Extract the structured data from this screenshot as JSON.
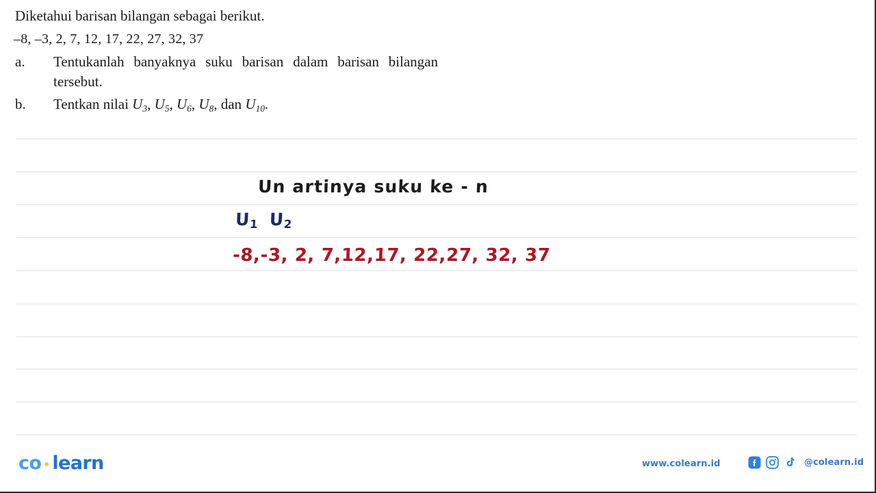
{
  "question": {
    "intro": "Diketahui barisan bilangan sebagai berikut.",
    "sequence": "–8, –3, 2, 7, 12, 17, 22, 27, 32, 37",
    "items": [
      {
        "label": "a.",
        "text": "Tentukanlah banyaknya suku barisan dalam barisan bilangan tersebut."
      },
      {
        "label": "b.",
        "text_prefix": "Tentkan nilai ",
        "terms": [
          "U3",
          "U5",
          "U6",
          "U8"
        ],
        "conjunction": "dan ",
        "last_term": "U10",
        "terms_display": [
          "U",
          "3",
          "U",
          "5",
          "U",
          "6",
          "U",
          "8",
          "U",
          "10"
        ]
      }
    ],
    "b_label": "b.",
    "b_lead": "Tentkan nilai",
    "b_sub1": "3",
    "b_sub2": "5",
    "b_sub3": "6",
    "b_sub4": "8",
    "b_dan": "dan",
    "b_sub5": "10",
    "b_U": "U",
    "b_end": "."
  },
  "handwriting": {
    "note_title_main": "Un",
    "note_title_rest": " artinya suku ke - n",
    "u_first": "U",
    "u_first_sub": "1",
    "u_second": "U",
    "u_second_sub": "2",
    "red_sequence": "-8,-3, 2, 7,12,17, 22,27, 32, 37",
    "colors": {
      "black_ink": "#1b1b1b",
      "blue_ink": "#1d2b63",
      "red_ink": "#ad1723"
    }
  },
  "rules": {
    "line_positions": [
      202,
      250,
      298,
      346,
      394,
      443,
      491,
      538,
      586,
      634
    ],
    "color": "#ececec"
  },
  "footer": {
    "logo_first": "co",
    "logo_second": "learn",
    "website": "www.colearn.id",
    "handle": "@colearn.id",
    "socials": [
      {
        "name": "facebook-icon",
        "glyph": "f"
      },
      {
        "name": "instagram-icon",
        "glyph": ""
      },
      {
        "name": "tiktok-icon",
        "glyph": ""
      }
    ],
    "colors": {
      "logo_co": "#4a9cf0",
      "logo_dot": "#f5c542",
      "logo_learn": "#2072d4",
      "link": "#3a77c9"
    }
  }
}
